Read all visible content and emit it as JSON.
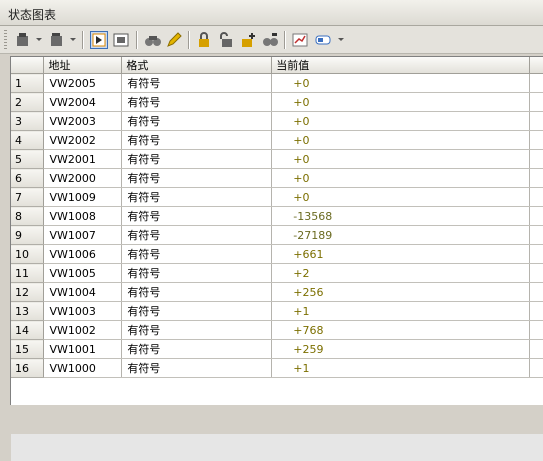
{
  "window": {
    "title": "状态图表"
  },
  "toolbar": {
    "icons": [
      "insert-row-icon",
      "dropdown",
      "delete-row-icon",
      "dropdown",
      "trend-view-icon",
      "table-view-icon",
      "binoculars-icon",
      "pencil-icon",
      "lock-icon",
      "unlock-icon",
      "force-icon",
      "unforce-icon",
      "chart-icon",
      "display-format-icon",
      "dropdown"
    ]
  },
  "table": {
    "headers": [
      "",
      "地址",
      "格式",
      "当前值",
      ""
    ],
    "rows": [
      {
        "n": "1",
        "addr": "VW2005",
        "fmt": "有符号",
        "val": "+0"
      },
      {
        "n": "2",
        "addr": "VW2004",
        "fmt": "有符号",
        "val": "+0"
      },
      {
        "n": "3",
        "addr": "VW2003",
        "fmt": "有符号",
        "val": "+0"
      },
      {
        "n": "4",
        "addr": "VW2002",
        "fmt": "有符号",
        "val": "+0"
      },
      {
        "n": "5",
        "addr": "VW2001",
        "fmt": "有符号",
        "val": "+0"
      },
      {
        "n": "6",
        "addr": "VW2000",
        "fmt": "有符号",
        "val": "+0"
      },
      {
        "n": "7",
        "addr": "VW1009",
        "fmt": "有符号",
        "val": "+0"
      },
      {
        "n": "8",
        "addr": "VW1008",
        "fmt": "有符号",
        "val": "-13568"
      },
      {
        "n": "9",
        "addr": "VW1007",
        "fmt": "有符号",
        "val": "-27189"
      },
      {
        "n": "10",
        "addr": "VW1006",
        "fmt": "有符号",
        "val": "+661"
      },
      {
        "n": "11",
        "addr": "VW1005",
        "fmt": "有符号",
        "val": "+2"
      },
      {
        "n": "12",
        "addr": "VW1004",
        "fmt": "有符号",
        "val": "+256"
      },
      {
        "n": "13",
        "addr": "VW1003",
        "fmt": "有符号",
        "val": "+1"
      },
      {
        "n": "14",
        "addr": "VW1002",
        "fmt": "有符号",
        "val": "+768"
      },
      {
        "n": "15",
        "addr": "VW1001",
        "fmt": "有符号",
        "val": "+259"
      },
      {
        "n": "16",
        "addr": "VW1000",
        "fmt": "有符号",
        "val": "+1"
      }
    ]
  },
  "colors": {
    "value_text": "#7c6f00",
    "active_button": "#3d6fb6"
  }
}
